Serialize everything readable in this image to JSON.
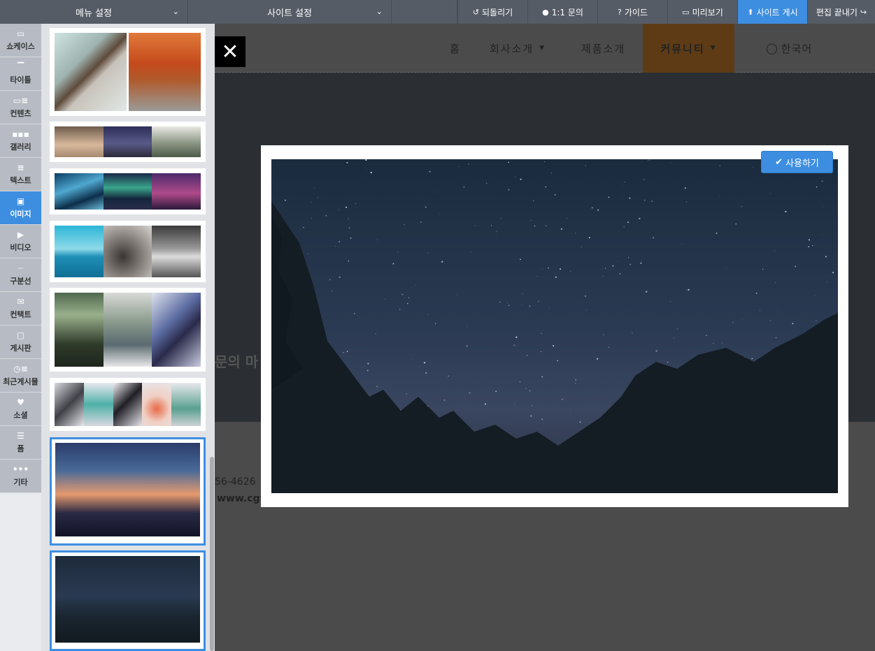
{
  "topbar": {
    "menu_settings": "메뉴 설정",
    "site_settings": "사이트 설정",
    "undo": "되돌리기",
    "inquiry": "1:1 문의",
    "guide": "가이드",
    "preview": "미리보기",
    "publish": "사이트 게시",
    "finish": "편집 끝내기"
  },
  "nav": [
    {
      "label": "쇼케이스",
      "icon": "showcase-icon"
    },
    {
      "label": "타이틀",
      "icon": "title-icon"
    },
    {
      "label": "컨텐츠",
      "icon": "content-icon"
    },
    {
      "label": "갤러리",
      "icon": "gallery-icon"
    },
    {
      "label": "텍스트",
      "icon": "text-icon"
    },
    {
      "label": "이미지",
      "icon": "image-icon"
    },
    {
      "label": "비디오",
      "icon": "video-icon"
    },
    {
      "label": "구분선",
      "icon": "divider-icon"
    },
    {
      "label": "컨택트",
      "icon": "contact-icon"
    },
    {
      "label": "게시판",
      "icon": "board-icon"
    },
    {
      "label": "최근게시물",
      "icon": "recent-posts-icon"
    },
    {
      "label": "소셜",
      "icon": "social-icon"
    },
    {
      "label": "폼",
      "icon": "form-icon"
    },
    {
      "label": "기타",
      "icon": "more-icon"
    }
  ],
  "site": {
    "menu_home": "홈",
    "menu_about": "회사소개",
    "menu_products": "제품소개",
    "menu_community": "커뮤니티",
    "language": "한국어",
    "hero_text": "문의 마",
    "phone_fragment": "56-4626",
    "url_fragment": "www.cgf"
  },
  "modal": {
    "use_button": "사용하기"
  },
  "colors": {
    "accent": "#3d8ee0",
    "topbar": "#565c66",
    "community_bg": "#5e3b15"
  }
}
